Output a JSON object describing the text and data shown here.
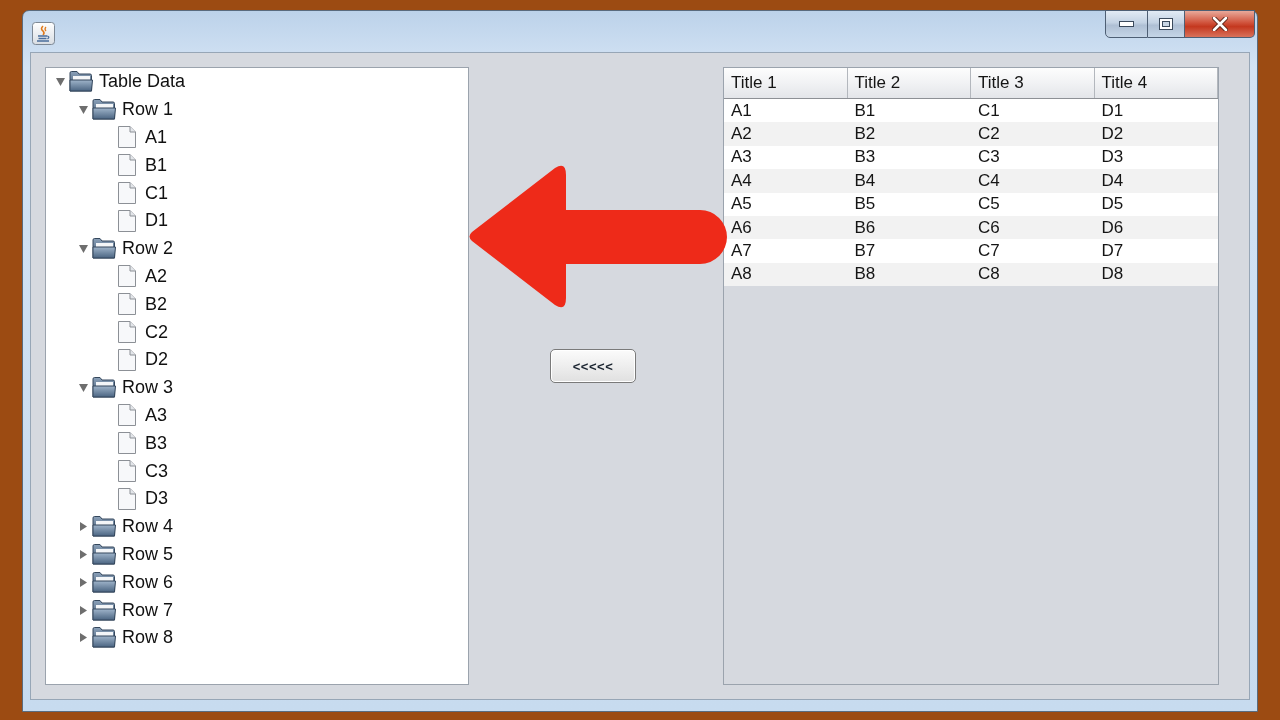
{
  "tree": {
    "nodes": [
      {
        "kind": "folder",
        "label": "Table Data",
        "expanded": true,
        "children": [
          {
            "kind": "folder",
            "label": "Row 1",
            "expanded": true,
            "children": [
              {
                "kind": "file",
                "label": "A1"
              },
              {
                "kind": "file",
                "label": "B1"
              },
              {
                "kind": "file",
                "label": "C1"
              },
              {
                "kind": "file",
                "label": "D1"
              }
            ]
          },
          {
            "kind": "folder",
            "label": "Row 2",
            "expanded": true,
            "children": [
              {
                "kind": "file",
                "label": "A2"
              },
              {
                "kind": "file",
                "label": "B2"
              },
              {
                "kind": "file",
                "label": "C2"
              },
              {
                "kind": "file",
                "label": "D2"
              }
            ]
          },
          {
            "kind": "folder",
            "label": "Row 3",
            "expanded": true,
            "children": [
              {
                "kind": "file",
                "label": "A3"
              },
              {
                "kind": "file",
                "label": "B3"
              },
              {
                "kind": "file",
                "label": "C3"
              },
              {
                "kind": "file",
                "label": "D3"
              }
            ]
          },
          {
            "kind": "folder",
            "label": "Row 4",
            "expanded": false
          },
          {
            "kind": "folder",
            "label": "Row 5",
            "expanded": false
          },
          {
            "kind": "folder",
            "label": "Row 6",
            "expanded": false
          },
          {
            "kind": "folder",
            "label": "Row 7",
            "expanded": false
          },
          {
            "kind": "folder",
            "label": "Row 8",
            "expanded": false
          }
        ]
      }
    ]
  },
  "transfer_button": {
    "label": "<<<<<"
  },
  "table": {
    "columns": [
      "Title 1",
      "Title 2",
      "Title 3",
      "Title 4"
    ],
    "rows": [
      [
        "A1",
        "B1",
        "C1",
        "D1"
      ],
      [
        "A2",
        "B2",
        "C2",
        "D2"
      ],
      [
        "A3",
        "B3",
        "C3",
        "D3"
      ],
      [
        "A4",
        "B4",
        "C4",
        "D4"
      ],
      [
        "A5",
        "B5",
        "C5",
        "D5"
      ],
      [
        "A6",
        "B6",
        "C6",
        "D6"
      ],
      [
        "A7",
        "B7",
        "C7",
        "D7"
      ],
      [
        "A8",
        "B8",
        "C8",
        "D8"
      ]
    ]
  }
}
